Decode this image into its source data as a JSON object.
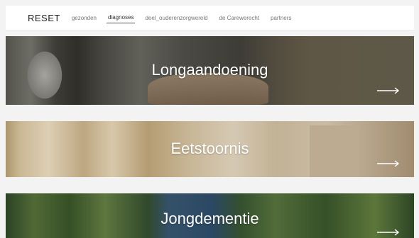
{
  "header": {
    "brand": "RESET",
    "nav": [
      {
        "label": "gezonden",
        "active": false
      },
      {
        "label": "diagnoses",
        "active": true
      },
      {
        "label": "deel_ouderenzorgwereld",
        "active": false
      },
      {
        "label": "de Carewerecht",
        "active": false
      },
      {
        "label": "partners",
        "active": false
      }
    ]
  },
  "cards": [
    {
      "title": "Longaandoening",
      "arrow_icon": "arrow-right-icon",
      "scene": "hospital equipment with hand"
    },
    {
      "title": "Eetstoornis",
      "arrow_icon": "arrow-right-icon",
      "scene": "bright corridor"
    },
    {
      "title": "Jongdementie",
      "arrow_icon": "arrow-right-icon",
      "scene": "people walking in garden"
    }
  ],
  "colors": {
    "background": "#f3f3f3",
    "card_text": "#ffffff"
  }
}
